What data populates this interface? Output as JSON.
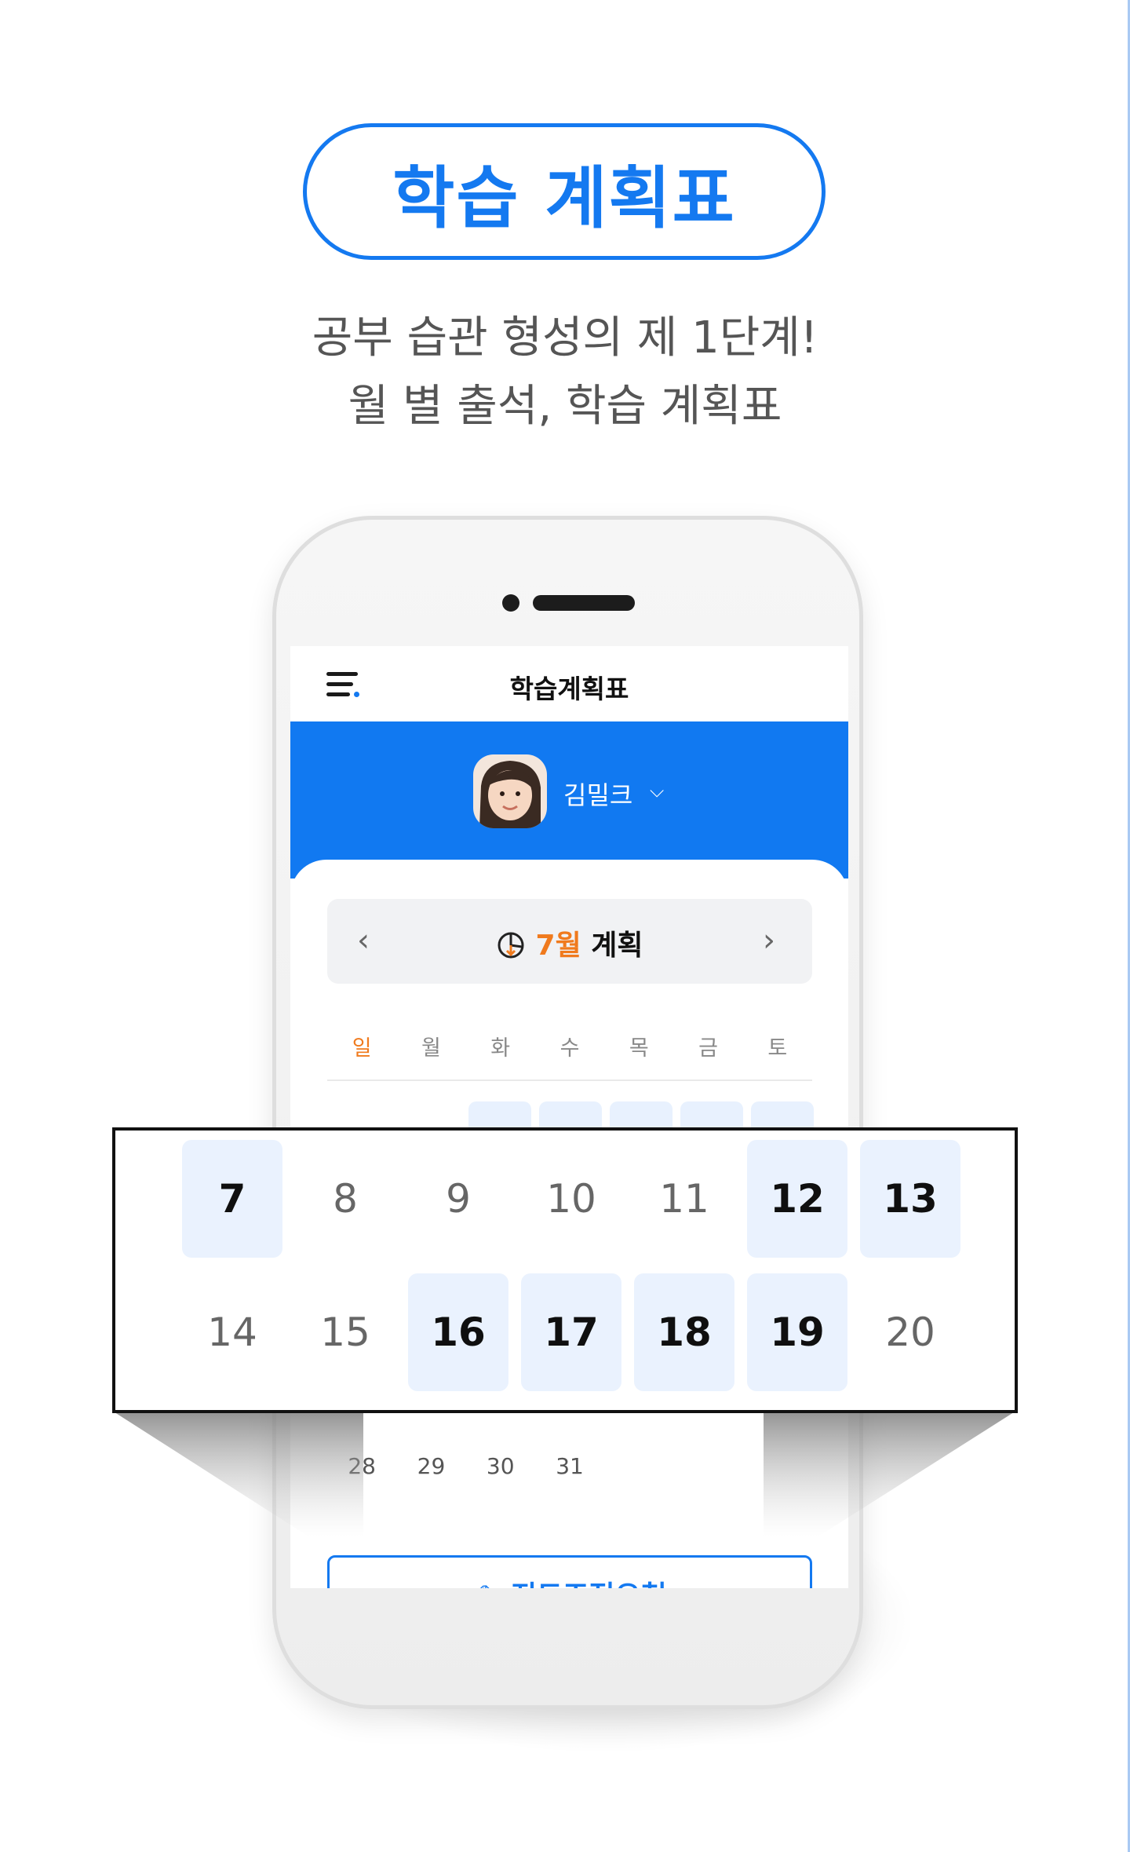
{
  "header": {
    "title": "학습 계획표",
    "subtitle_line1": "공부 습관 형성의 제 1단계!",
    "subtitle_line2": "월 별 출석, 학습 계획표"
  },
  "app": {
    "title": "학습계획표",
    "child_name": "김밀크",
    "month_number": "7월",
    "month_suffix": "계획",
    "weekdays": [
      "일",
      "월",
      "화",
      "수",
      "목",
      "금",
      "토"
    ],
    "cta_label": "진도조정요청",
    "last_row": [
      "28",
      "29",
      "30",
      "31"
    ]
  },
  "callout": {
    "rows": [
      [
        {
          "day": "7",
          "highlighted": true
        },
        {
          "day": "8",
          "highlighted": false
        },
        {
          "day": "9",
          "highlighted": false
        },
        {
          "day": "10",
          "highlighted": false
        },
        {
          "day": "11",
          "highlighted": false
        },
        {
          "day": "12",
          "highlighted": true
        },
        {
          "day": "13",
          "highlighted": true
        }
      ],
      [
        {
          "day": "14",
          "highlighted": false
        },
        {
          "day": "15",
          "highlighted": false
        },
        {
          "day": "16",
          "highlighted": true
        },
        {
          "day": "17",
          "highlighted": true
        },
        {
          "day": "18",
          "highlighted": true
        },
        {
          "day": "19",
          "highlighted": true
        },
        {
          "day": "20",
          "highlighted": false
        }
      ]
    ]
  },
  "colors": {
    "brand_blue": "#1479f0",
    "sunday_orange": "#f07a1d",
    "highlight_cell": "#eaf2fe"
  },
  "icons": [
    "menu-icon",
    "chevron-down-icon",
    "chevron-left-icon",
    "chevron-right-icon",
    "pie-chart-icon",
    "pencil-ruler-icon"
  ]
}
